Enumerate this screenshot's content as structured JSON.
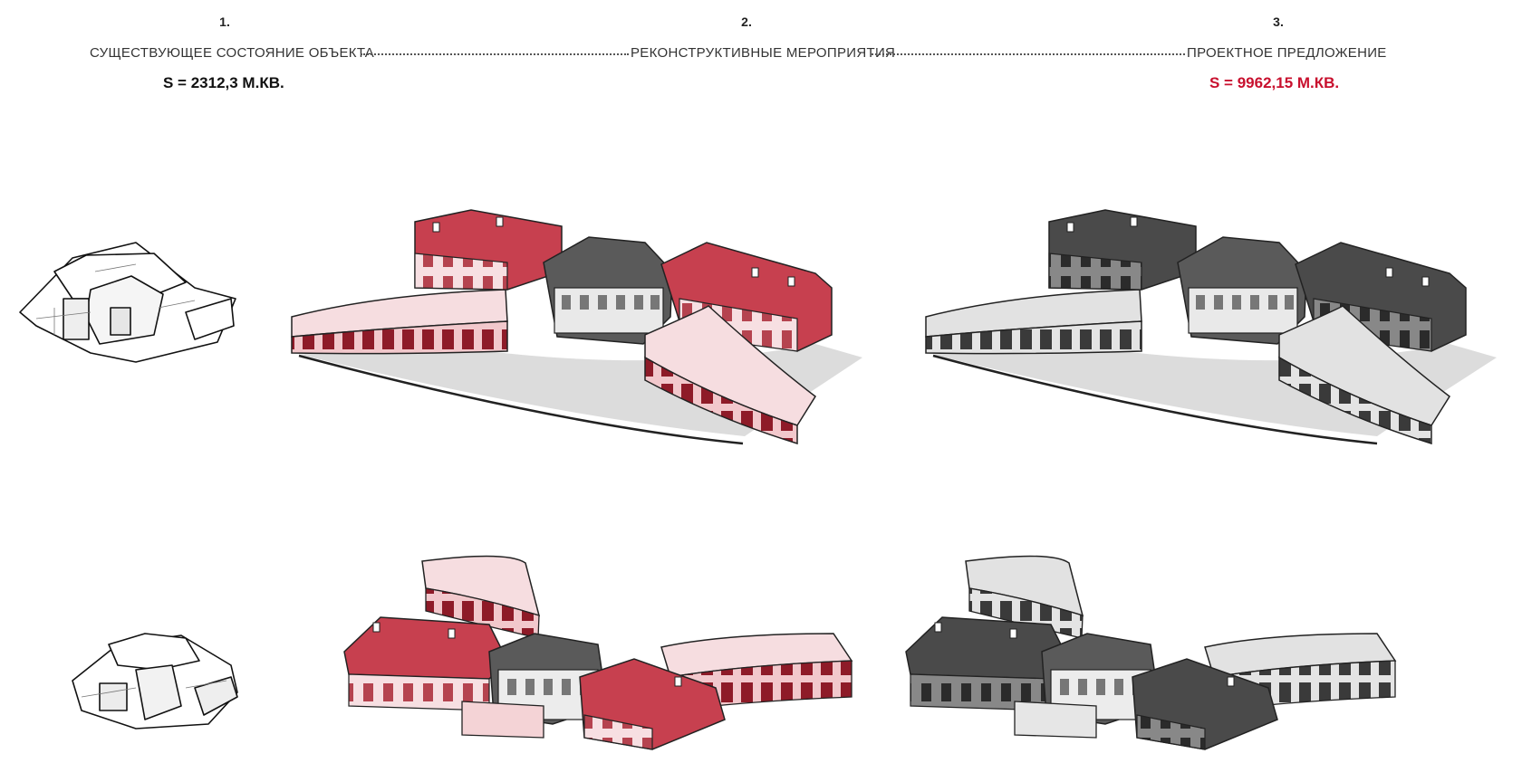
{
  "stages": [
    {
      "number": "1.",
      "title": "СУЩЕСТВУЮЩЕЕ СОСТОЯНИЕ ОБЪЕКТА",
      "area": "S = 2312,3 М.КВ."
    },
    {
      "number": "2.",
      "title": "РЕКОНСТРУКТИВНЫЕ МЕРОПРИЯТИЯ"
    },
    {
      "number": "3.",
      "title": "ПРОЕКТНОЕ ПРЕДЛОЖЕНИЕ",
      "area": "S = 9962,15 М.КВ."
    }
  ],
  "colors": {
    "accent_red": "#c8102e",
    "new_volume_red": "#c7404f",
    "new_volume_pink": "#f4d3d6",
    "proposed_dark": "#4a4a4a",
    "proposed_light": "#dedede",
    "existing_white": "#ffffff"
  },
  "drawings": [
    {
      "name": "existing-building-axonometry-view-1"
    },
    {
      "name": "reconstruction-axonometry-view-1"
    },
    {
      "name": "proposal-axonometry-view-1"
    },
    {
      "name": "existing-building-axonometry-view-2"
    },
    {
      "name": "reconstruction-axonometry-view-2"
    },
    {
      "name": "proposal-axonometry-view-2"
    }
  ]
}
